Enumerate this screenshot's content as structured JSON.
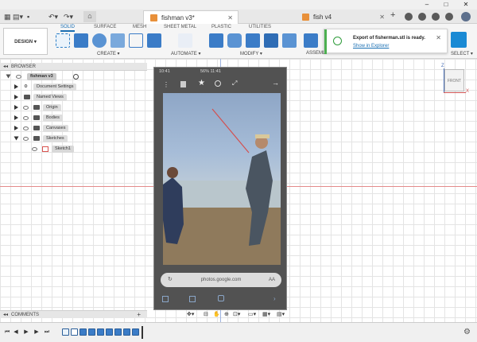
{
  "window": {
    "controls": [
      "–",
      "□",
      "✕"
    ]
  },
  "tabs": [
    {
      "label": "fishman v3*",
      "active": true
    },
    {
      "label": "fish v4",
      "active": false
    }
  ],
  "ribbon": {
    "workspace": "DESIGN",
    "tabs": [
      "SOLID",
      "SURFACE",
      "MESH",
      "SHEET METAL",
      "PLASTIC",
      "UTILITIES"
    ],
    "groups": [
      "CREATE ▾",
      "AUTOMATE ▾",
      "MODIFY ▾",
      "ASSEMB",
      "SELECT ▾"
    ]
  },
  "toast": {
    "message": "Export of fisherman.stl is ready.",
    "link": "Show in Explorer"
  },
  "browser": {
    "title": "BROWSER",
    "root": "fishman v3",
    "items": [
      {
        "label": "Document Settings"
      },
      {
        "label": "Named Views"
      },
      {
        "label": "Origin"
      },
      {
        "label": "Bodies"
      },
      {
        "label": "Canvases"
      },
      {
        "label": "Sketches"
      },
      {
        "label": "Sketch1"
      }
    ]
  },
  "phone": {
    "status_left": "10:41",
    "status_right": "56% 11:41",
    "url": "photos.google.com",
    "url_left": "AA"
  },
  "viewcube": {
    "label": "FRONT",
    "axis_x": "X",
    "axis_z": "Z"
  },
  "comments": {
    "title": "COMMENTS"
  },
  "colors": {
    "accent": "#1a6fb3",
    "toast_success": "#2e9c3a",
    "x_axis": "#e48b8b",
    "z_axis": "#9db3e0",
    "tab_cube": "#e8903a",
    "timeline_feature": "#3b7cc7"
  }
}
